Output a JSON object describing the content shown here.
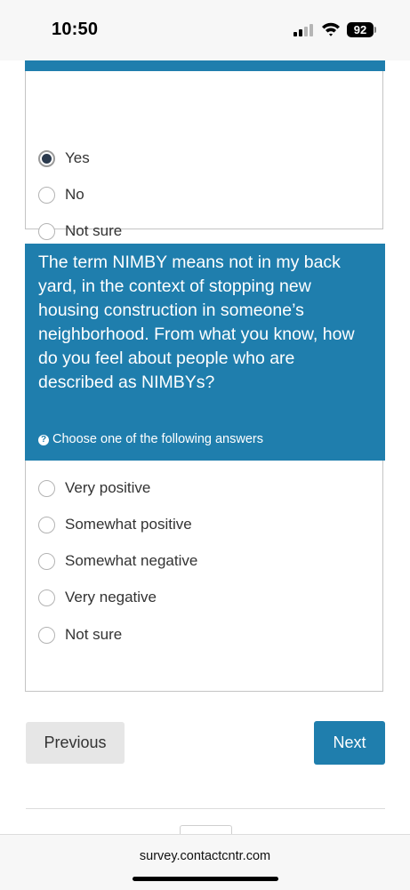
{
  "status_bar": {
    "time": "10:50",
    "battery_level": "92"
  },
  "question1": {
    "options": [
      {
        "label": "Yes",
        "selected": true
      },
      {
        "label": "No",
        "selected": false
      },
      {
        "label": "Not sure",
        "selected": false
      }
    ]
  },
  "question2": {
    "text": "The term NIMBY means not in my back yard, in the context of stopping new housing construction in someone’s neighborhood. From what you know, how do you feel about people who are described as NIMBYs?",
    "hint": "Choose one of the following answers",
    "options": [
      {
        "label": "Very positive",
        "selected": false
      },
      {
        "label": "Somewhat positive",
        "selected": false
      },
      {
        "label": "Somewhat negative",
        "selected": false
      },
      {
        "label": "Very negative",
        "selected": false
      },
      {
        "label": "Not sure",
        "selected": false
      }
    ]
  },
  "navigation": {
    "previous_label": "Previous",
    "next_label": "Next"
  },
  "browser": {
    "url": "survey.contactcntr.com"
  },
  "colors": {
    "accent": "#1f7ead",
    "selected_dot": "#2b3a4e"
  }
}
